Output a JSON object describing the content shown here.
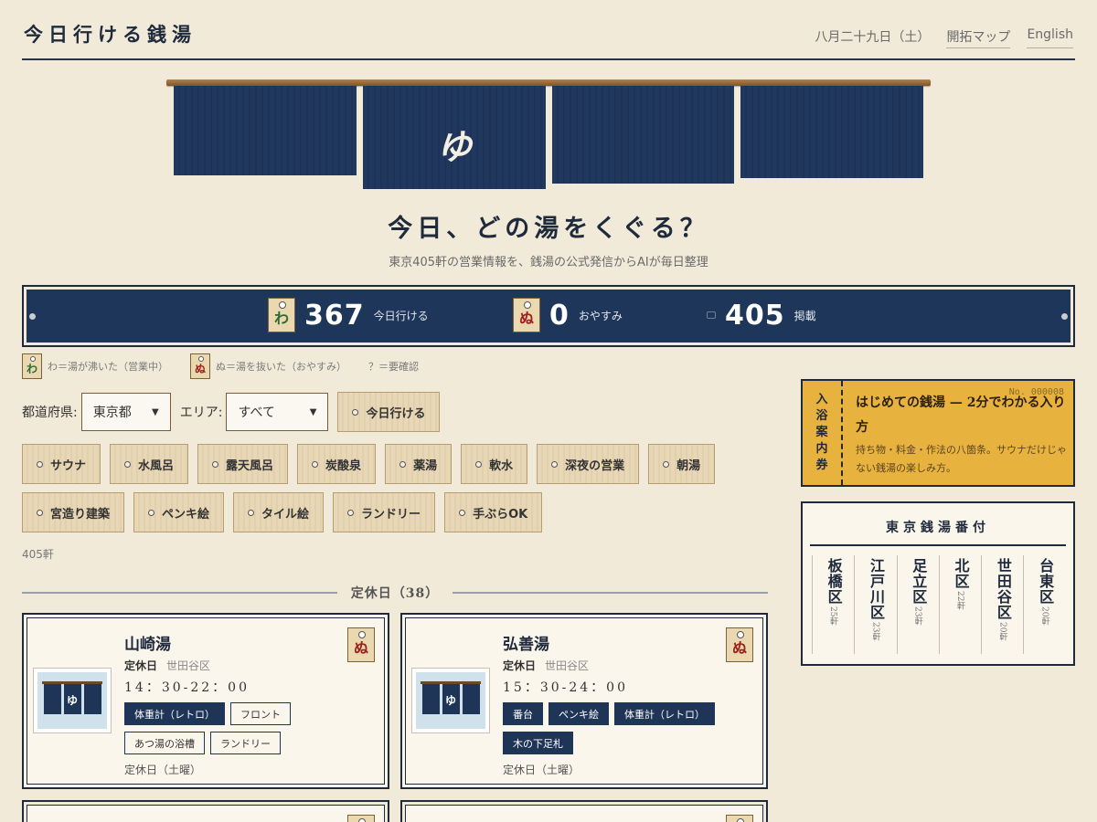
{
  "header": {
    "title": "今日行ける銭湯",
    "date": "八月二十九日（土）",
    "map_link": "開拓マップ",
    "lang_link": "English"
  },
  "hero": {
    "noren_char": "ゆ",
    "title": "今日、どの湯をくぐる？",
    "subtitle": "東京405軒の営業情報を、銭湯の公式発信からAIが毎日整理"
  },
  "stats": {
    "open_tag": "わ",
    "open_count": "367",
    "open_label": "今日行ける",
    "closed_tag": "ぬ",
    "closed_count": "0",
    "closed_label": "おやすみ",
    "listed_count": "405",
    "listed_label": "掲載"
  },
  "legend": {
    "open_tag": "わ",
    "open_text": "わ＝湯が沸いた（営業中）",
    "closed_tag": "ぬ",
    "closed_text": "ぬ＝湯を抜いた（おやすみ）",
    "unknown_text": "？＝要確認"
  },
  "filters": {
    "pref_label": "都道府県:",
    "pref_value": "東京都",
    "area_label": "エリア:",
    "area_value": "すべて",
    "today_button": "今日行ける",
    "chips_row1": [
      "サウナ",
      "水風呂",
      "露天風呂",
      "炭酸泉",
      "薬湯",
      "軟水",
      "深夜の営業",
      "朝湯"
    ],
    "chips_row2": [
      "宮造り建築",
      "ペンキ絵",
      "タイル絵",
      "ランドリー",
      "手ぶらOK"
    ]
  },
  "result_count": "405軒",
  "section": {
    "title": "定休日（38）"
  },
  "cards": [
    {
      "name": "山崎湯",
      "status": "定休日",
      "area": "世田谷区",
      "hours": "14：30-22：00",
      "tag": "ぬ",
      "thumb_char": "ゆ",
      "tags": [
        {
          "label": "体重計（レトロ）",
          "style": "dark"
        },
        {
          "label": "フロント",
          "style": "light"
        },
        {
          "label": "あつ湯の浴槽",
          "style": "light"
        },
        {
          "label": "ランドリー",
          "style": "light"
        }
      ],
      "footer": "定休日（土曜）"
    },
    {
      "name": "弘善湯",
      "status": "定休日",
      "area": "世田谷区",
      "hours": "15：30-24：00",
      "tag": "ぬ",
      "thumb_char": "ゆ",
      "tags": [
        {
          "label": "番台",
          "style": "dark"
        },
        {
          "label": "ペンキ絵",
          "style": "dark"
        },
        {
          "label": "体重計（レトロ）",
          "style": "dark"
        },
        {
          "label": "木の下足札",
          "style": "dark"
        }
      ],
      "footer": "定休日（土曜）"
    }
  ],
  "ticket": {
    "side": "入浴案内券",
    "number": "No. 000008",
    "title": "はじめての銭湯 — 2分でわかる入り方",
    "desc": "持ち物・料金・作法の八箇条。サウナだけじゃない銭湯の楽しみ方。"
  },
  "banzuke": {
    "title": "東京銭湯番付",
    "wards": [
      {
        "name": "板橋区",
        "count": "25軒"
      },
      {
        "name": "江戸川区",
        "count": "23軒"
      },
      {
        "name": "足立区",
        "count": "23軒"
      },
      {
        "name": "北区",
        "count": "22軒"
      },
      {
        "name": "世田谷区",
        "count": "20軒"
      },
      {
        "name": "台東区",
        "count": "20軒"
      }
    ]
  },
  "colors": {
    "background": "#f1ead9",
    "indigo": "#1e365a",
    "ticket": "#e8b23e",
    "tag_open": "#2e6b34",
    "tag_closed": "#a02020"
  }
}
